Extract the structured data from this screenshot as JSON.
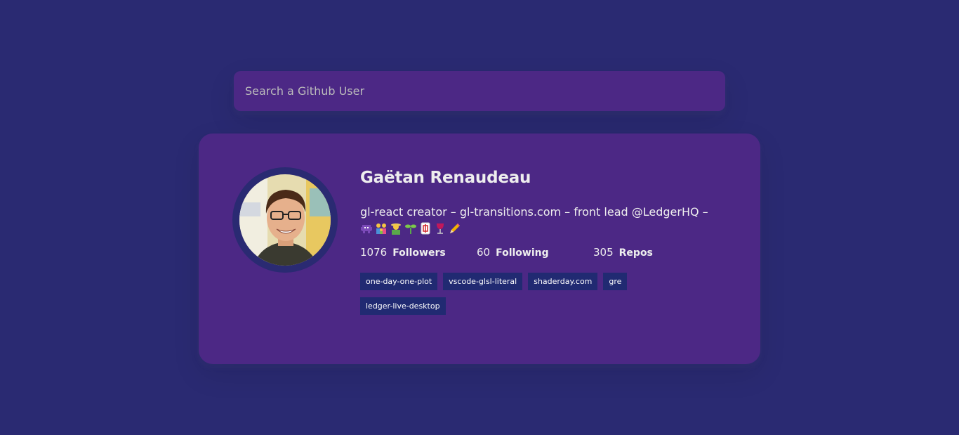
{
  "search": {
    "placeholder": "Search a Github User",
    "value": ""
  },
  "user": {
    "name": "Gaëtan Renaudeau",
    "bio": "gl-react creator – gl-transitions.com – front lead @LedgerHQ –",
    "bio_emojis": [
      "alien-monster-emoji",
      "family-emoji",
      "man-farmer-emoji",
      "seedling-emoji",
      "mahjong-tile-emoji",
      "wine-glass-emoji",
      "pencil-emoji"
    ],
    "avatar_icon": "user-avatar-photo"
  },
  "stats": [
    {
      "value": "1076",
      "label": "Followers"
    },
    {
      "value": "60",
      "label": "Following"
    },
    {
      "value": "305",
      "label": "Repos"
    }
  ],
  "repos": [
    "one-day-one-plot",
    "vscode-glsl-literal",
    "shaderday.com",
    "gre",
    "ledger-live-desktop"
  ],
  "colors": {
    "background": "#2a2a72",
    "card": "#4c2885",
    "repo_badge": "#212a72",
    "text": "#eeeeee"
  }
}
